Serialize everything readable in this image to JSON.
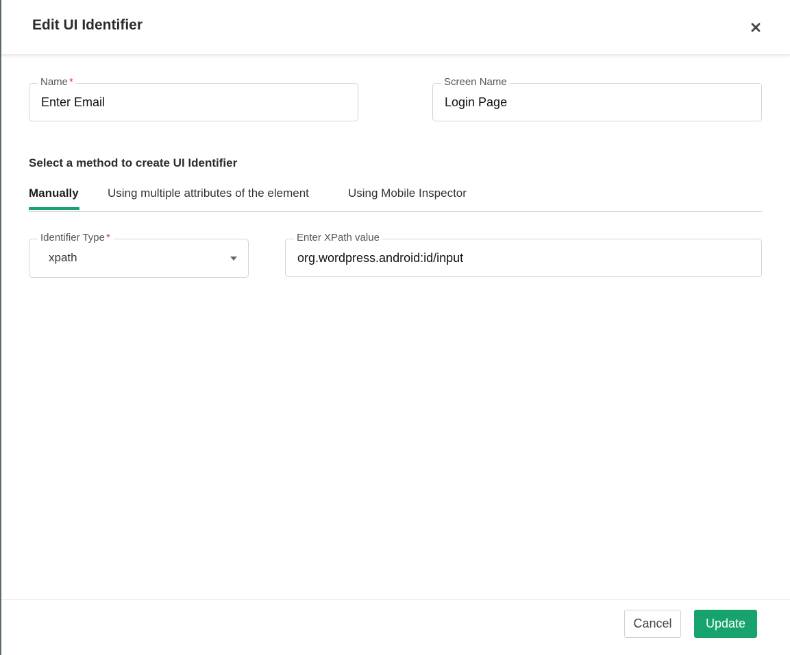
{
  "dialog": {
    "title": "Edit UI Identifier",
    "close_label": "close"
  },
  "form": {
    "name": {
      "label": "Name",
      "required_mark": "*",
      "value": "Enter Email"
    },
    "screen_name": {
      "label": "Screen Name",
      "value": "Login Page"
    }
  },
  "method": {
    "heading": "Select a method to create UI Identifier",
    "tabs": [
      {
        "label": "Manually",
        "active": true
      },
      {
        "label": "Using multiple attributes of the element",
        "active": false
      },
      {
        "label": "Using Mobile Inspector",
        "active": false
      }
    ],
    "identifier_type": {
      "label": "Identifier Type",
      "required_mark": "*",
      "value": "xpath"
    },
    "xpath": {
      "label": "Enter XPath value",
      "value": "org.wordpress.android:id/input"
    }
  },
  "footer": {
    "cancel_label": "Cancel",
    "update_label": "Update"
  },
  "colors": {
    "accent": "#16a36d",
    "required": "#e0393e"
  }
}
